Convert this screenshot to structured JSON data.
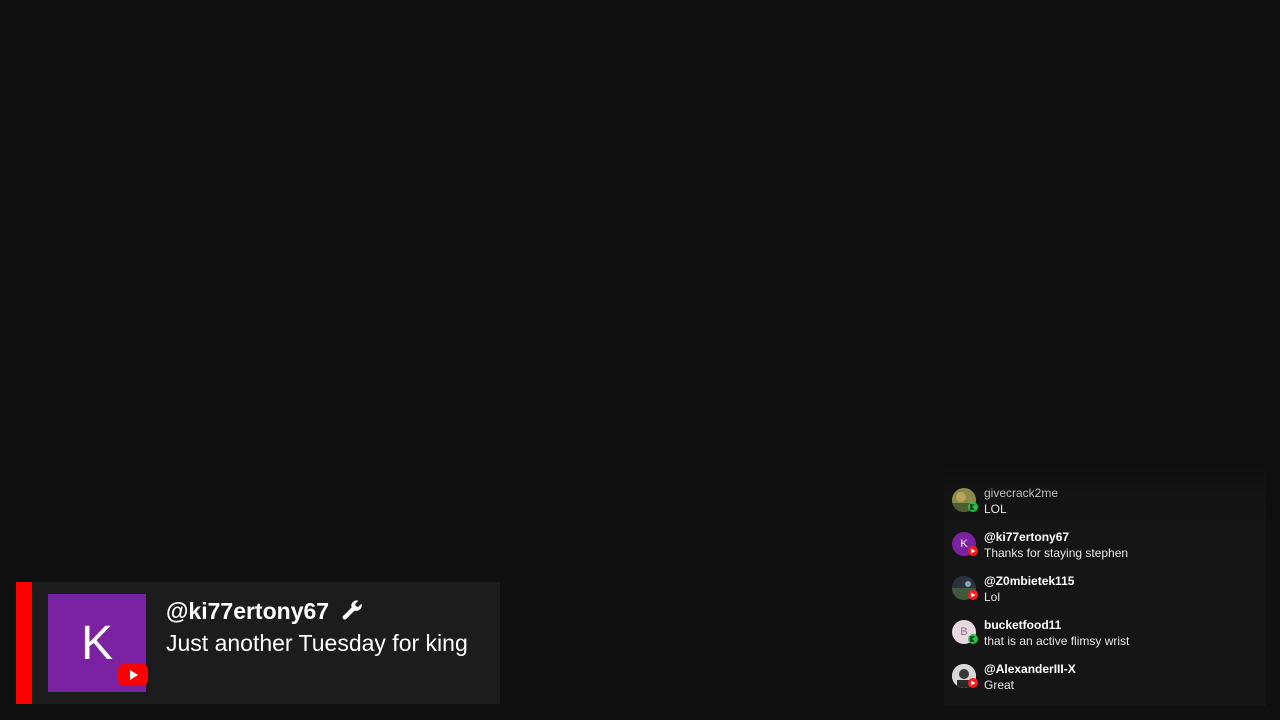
{
  "featured": {
    "avatar_letter": "K",
    "username": "@ki77ertony67",
    "message": "Just another Tuesday for king",
    "accent_color": "#ff0000",
    "avatar_color": "#7b22a3",
    "badge_icon": "youtube-play-icon",
    "role_icon": "wrench-icon"
  },
  "chat": {
    "messages": [
      {
        "username": "givecrack2me",
        "text": "LOL",
        "avatar_letter": "",
        "platform": "kick"
      },
      {
        "username": "@ki77ertony67",
        "text": "Thanks for staying stephen",
        "avatar_letter": "K",
        "platform": "youtube"
      },
      {
        "username": "@Z0mbietek115",
        "text": "Lol",
        "avatar_letter": "",
        "platform": "youtube"
      },
      {
        "username": "bucketfood11",
        "text": "that is an active flimsy wrist",
        "avatar_letter": "B",
        "platform": "kick"
      },
      {
        "username": "@AlexanderIII-X",
        "text": "Great",
        "avatar_letter": "",
        "platform": "youtube"
      }
    ]
  },
  "colors": {
    "background": "#0f0f0f",
    "youtube_red": "#ff0000",
    "kick_green": "#27c23b"
  }
}
